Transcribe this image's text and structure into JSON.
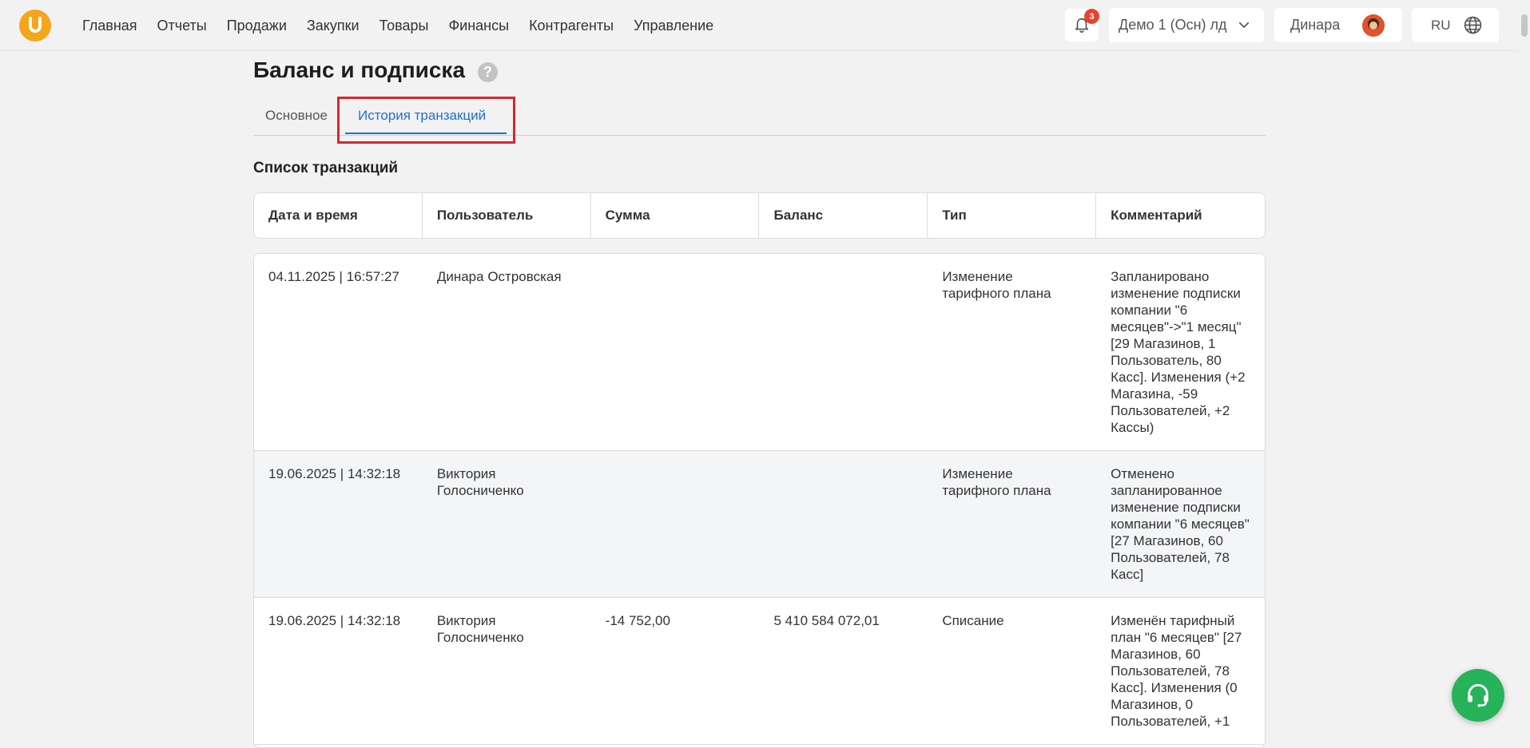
{
  "nav": {
    "items": [
      "Главная",
      "Отчеты",
      "Продажи",
      "Закупки",
      "Товары",
      "Финансы",
      "Контрагенты",
      "Управление"
    ]
  },
  "header": {
    "notifications_count": "3",
    "company": "Демо 1 (Осн) лд",
    "user": "Динара",
    "language": "RU"
  },
  "page": {
    "title": "Баланс и подписка",
    "help": "?",
    "tabs": [
      "Основное",
      "История транзакций"
    ],
    "active_tab": "История транзакций",
    "section_title": "Список транзакций"
  },
  "table": {
    "columns": [
      "Дата и время",
      "Пользователь",
      "Сумма",
      "Баланс",
      "Тип",
      "Комментарий"
    ],
    "rows": [
      {
        "datetime": "04.11.2025 | 16:57:27",
        "user": "Динара Островская",
        "amount": "",
        "balance": "",
        "type": "Изменение тарифного плана",
        "comment": "Запланировано изменение подписки компании \"6 месяцев\"->\"1 месяц\" [29 Магазинов, 1 Пользователь, 80 Касс]. Изменения (+2 Магазина, -59 Пользователей, +2 Кассы)"
      },
      {
        "datetime": "19.06.2025 | 14:32:18",
        "user": "Виктория Голосниченко",
        "amount": "",
        "balance": "",
        "type": "Изменение тарифного плана",
        "comment": "Отменено запланированное изменение подписки компании \"6 месяцев\" [27 Магазинов, 60 Пользователей, 78 Касс]"
      },
      {
        "datetime": "19.06.2025 | 14:32:18",
        "user": "Виктория Голосниченко",
        "amount": "-14 752,00",
        "balance": "5 410 584 072,01",
        "type": "Списание",
        "comment": "Изменён тарифный план \"6 месяцев\" [27 Магазинов, 60 Пользователей, 78 Касс]. Изменения (0 Магазинов, 0 Пользователей, +1"
      }
    ]
  },
  "colors": {
    "accent": "#1f6ed4",
    "logo": "#f5a51b",
    "badge": "#e8432d",
    "highlight": "#d9262d",
    "support": "#27b35a"
  }
}
